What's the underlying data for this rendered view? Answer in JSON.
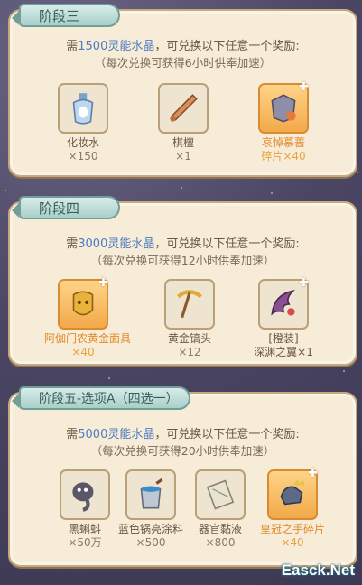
{
  "stages": [
    {
      "title": "阶段三",
      "requirement": {
        "prefix": "需",
        "amount": "1500灵能水晶",
        "suffix": "，可兑换以下任意一个奖励:"
      },
      "note": "（每次兑换可获得6小时供奉加速）",
      "rewards": [
        {
          "name": "化妆水",
          "qty": "×150",
          "highlight": false,
          "icon": "perfume-bottle-icon"
        },
        {
          "name": "棋檀",
          "qty": "×1",
          "highlight": false,
          "icon": "wooden-stick-icon"
        },
        {
          "name": "哀悼慕蔷",
          "name2": "碎片×40",
          "highlight": true,
          "icon": "armor-shard-icon"
        }
      ]
    },
    {
      "title": "阶段四",
      "requirement": {
        "prefix": "需",
        "amount": "3000灵能水晶",
        "suffix": "，可兑换以下任意一个奖励:"
      },
      "note": "（每次兑换可获得12小时供奉加速）",
      "rewards": [
        {
          "name": "阿伽门农黄金面具",
          "qty": "×40",
          "highlight": true,
          "icon": "golden-mask-icon"
        },
        {
          "name": "黄金镐头",
          "qty": "×12",
          "highlight": false,
          "icon": "pickaxe-icon"
        },
        {
          "name": "[橙装]",
          "name2": "深渊之翼×1",
          "highlight": false,
          "icon": "abyss-wing-icon"
        }
      ]
    },
    {
      "title": "阶段五-选项A（四选一）",
      "requirement": {
        "prefix": "需",
        "amount": "5000灵能水晶",
        "suffix": "，可兑换以下任意一个奖励:"
      },
      "note": "（每次兑换可获得20小时供奉加速）",
      "rewards": [
        {
          "name": "黑蝌蚪",
          "qty": "×50万",
          "highlight": false,
          "icon": "tadpole-icon"
        },
        {
          "name": "蓝色锅亮涂料",
          "qty": "×500",
          "highlight": false,
          "icon": "paint-bucket-icon"
        },
        {
          "name": "器官黏液",
          "qty": "×800",
          "highlight": false,
          "icon": "scroll-icon"
        },
        {
          "name": "皇冠之手碎片",
          "qty": "×40",
          "highlight": true,
          "icon": "crown-hand-icon"
        }
      ]
    }
  ],
  "watermark": "Easck.Net"
}
